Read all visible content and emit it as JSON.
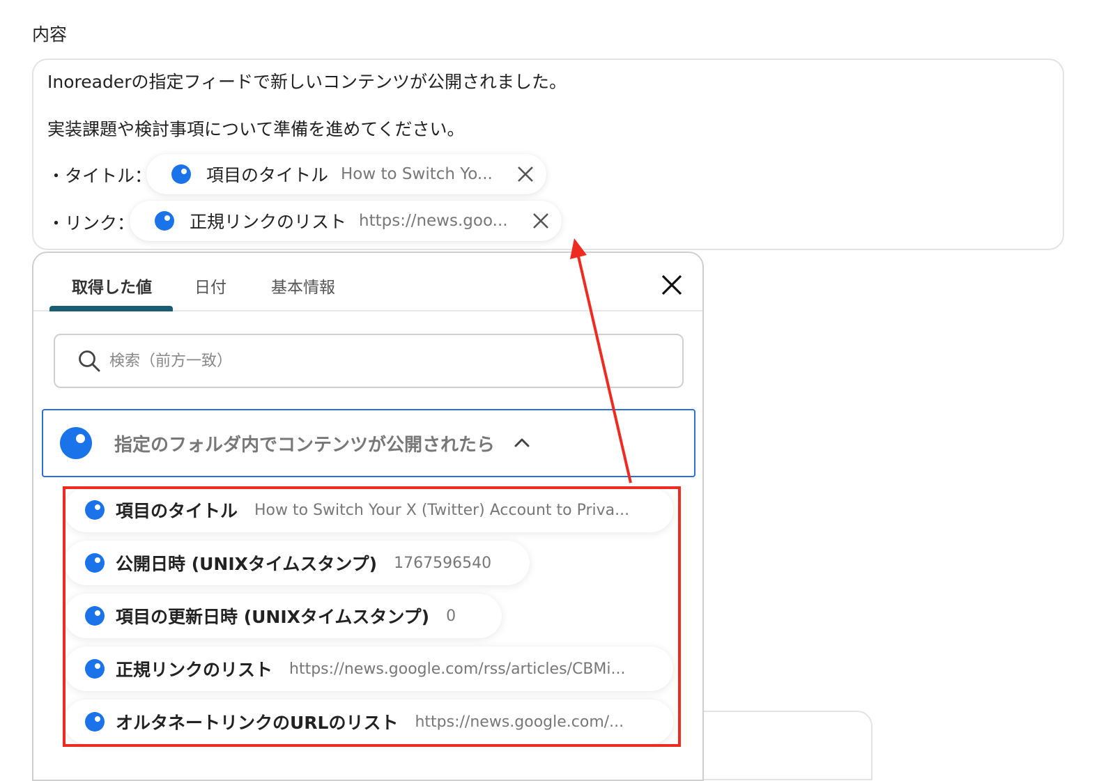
{
  "section": {
    "label": "内容"
  },
  "editor": {
    "line1": "Inoreaderの指定フィードで新しいコンテンツが公開されました。",
    "line2": "実装課題や検討事項について準備を進めてください。",
    "title_prefix": "・タイトル：",
    "link_prefix": "・リンク：",
    "chips": [
      {
        "label": "項目のタイトル",
        "value": "How to Switch Yo..."
      },
      {
        "label": "正規リンクのリスト",
        "value": "https://news.goo..."
      }
    ]
  },
  "panel": {
    "tabs": [
      {
        "label": "取得した値",
        "active": true
      },
      {
        "label": "日付",
        "active": false
      },
      {
        "label": "基本情報",
        "active": false
      }
    ],
    "search": {
      "placeholder": "検索（前方一致）",
      "value": ""
    },
    "group": {
      "label": "指定のフォルダ内でコンテンツが公開されたら",
      "expanded": true
    },
    "items": [
      {
        "label": "項目のタイトル",
        "value": "How to Switch Your X (Twitter) Account to Priva..."
      },
      {
        "label": "公開日時 (UNIXタイムスタンプ)",
        "value": "1767596540"
      },
      {
        "label": "項目の更新日時 (UNIXタイムスタンプ)",
        "value": "0"
      },
      {
        "label": "正規リンクのリスト",
        "value": "https://news.google.com/rss/articles/CBMi..."
      },
      {
        "label": "オルタネートリンクのURLのリスト",
        "value": "https://news.google.com/..."
      }
    ]
  },
  "colors": {
    "accent": "#1a73e8",
    "tab_indicator": "#1a5d72",
    "group_border": "#2a6fdb",
    "annotation": "#ee2b20"
  },
  "icons": {
    "chip_dot": "blue-circle-icon",
    "remove": "close-icon",
    "search": "search-icon",
    "collapse": "chevron-up-icon"
  }
}
